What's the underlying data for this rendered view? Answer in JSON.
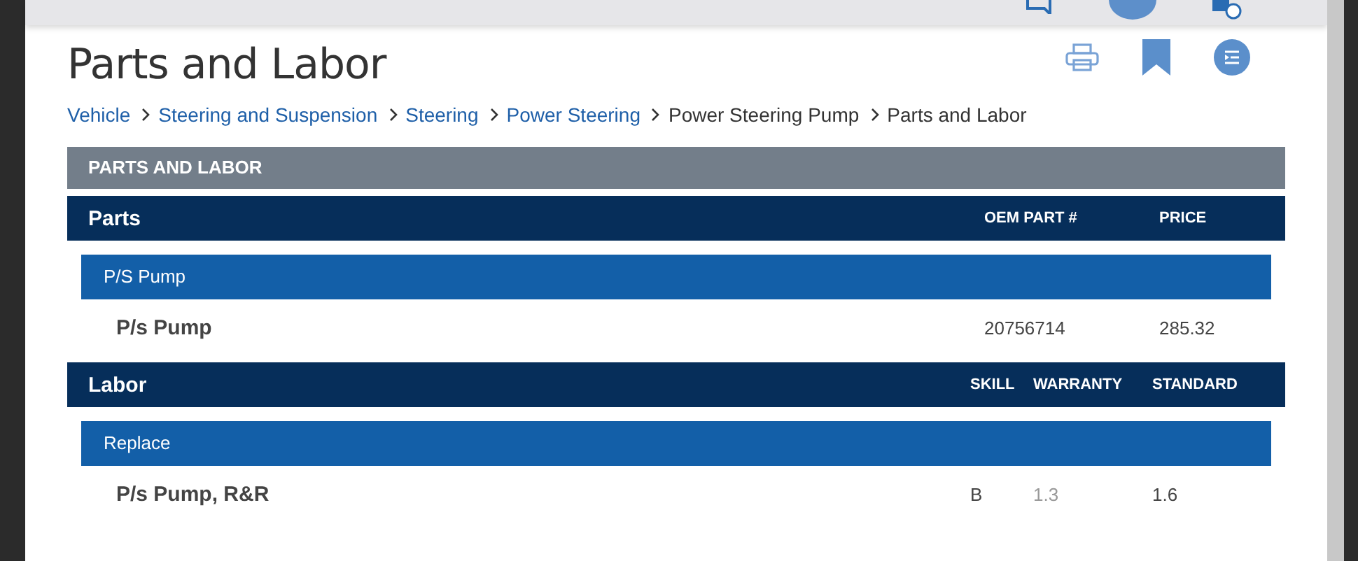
{
  "page_title": "Parts and Labor",
  "breadcrumb": [
    {
      "label": "Vehicle",
      "link": true
    },
    {
      "label": "Steering and Suspension",
      "link": true
    },
    {
      "label": "Steering",
      "link": true
    },
    {
      "label": "Power Steering",
      "link": true
    },
    {
      "label": "Power Steering Pump",
      "link": false
    },
    {
      "label": "Parts and Labor",
      "link": false
    }
  ],
  "section_title": "PARTS AND LABOR",
  "tables": [
    {
      "title": "Parts",
      "kind": "parts",
      "columns": [
        "OEM PART #",
        "PRICE"
      ],
      "groups": [
        {
          "title": "P/S Pump",
          "rows": [
            {
              "name": "P/s Pump",
              "cells": [
                {
                  "text": "20756714",
                  "dimmed": false
                },
                {
                  "text": "285.32",
                  "dimmed": false
                }
              ]
            }
          ]
        }
      ]
    },
    {
      "title": "Labor",
      "kind": "labor",
      "columns": [
        "SKILL",
        "WARRANTY",
        "STANDARD"
      ],
      "groups": [
        {
          "title": "Replace",
          "rows": [
            {
              "name": "P/s Pump, R&R",
              "cells": [
                {
                  "text": "B",
                  "dimmed": false
                },
                {
                  "text": "1.3",
                  "dimmed": true
                },
                {
                  "text": "1.6",
                  "dimmed": false
                }
              ]
            }
          ]
        }
      ]
    }
  ]
}
